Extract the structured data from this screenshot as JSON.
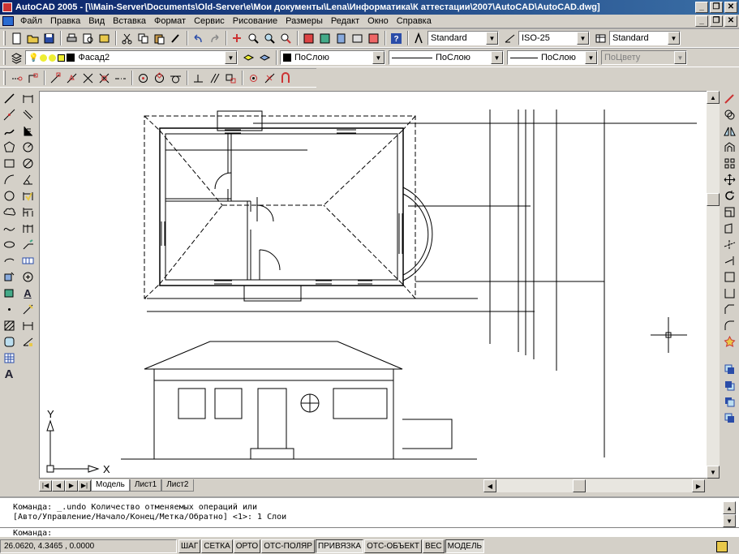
{
  "window": {
    "title": "AutoCAD 2005 - [\\\\Main-Server\\Documents\\Old-Server\\e\\Мои документы\\Lena\\Информатика\\К аттестации\\2007\\AutoCAD\\AutoCAD.dwg]",
    "minimize": "_",
    "restore": "❐",
    "close": "✕"
  },
  "menu": [
    "Файл",
    "Правка",
    "Вид",
    "Вставка",
    "Формат",
    "Сервис",
    "Рисование",
    "Размеры",
    "Редакт",
    "Окно",
    "Справка"
  ],
  "styles": {
    "text_style": "Standard",
    "dim_style": "ISO-25",
    "table_style": "Standard"
  },
  "layers": {
    "current_layer": "Фасад2",
    "color": "ПоСлою",
    "linetype": "ПоСлою",
    "lineweight": "ПоСлою",
    "plotstyle": "ПоЦвету"
  },
  "tabs": [
    "Модель",
    "Лист1",
    "Лист2"
  ],
  "ucs": {
    "x_label": "X",
    "y_label": "Y"
  },
  "command": {
    "history": [
      "Команда: _.undo Количество отменяемых операций или",
      "[Авто/Управление/Начало/Конец/Метка/Обратно] <1>: 1 Слои"
    ],
    "prompt": "Команда:"
  },
  "status": {
    "coords": "26.0620, 4.3465 , 0.0000",
    "buttons": [
      {
        "label": "ШАГ",
        "on": false
      },
      {
        "label": "СЕТКА",
        "on": false
      },
      {
        "label": "ОРТО",
        "on": false
      },
      {
        "label": "ОТС-ПОЛЯР",
        "on": false
      },
      {
        "label": "ПРИВЯЗКА",
        "on": true
      },
      {
        "label": "ОТС-ОБЪЕКТ",
        "on": false
      },
      {
        "label": "ВЕС",
        "on": false
      },
      {
        "label": "МОДЕЛЬ",
        "on": true
      }
    ]
  }
}
